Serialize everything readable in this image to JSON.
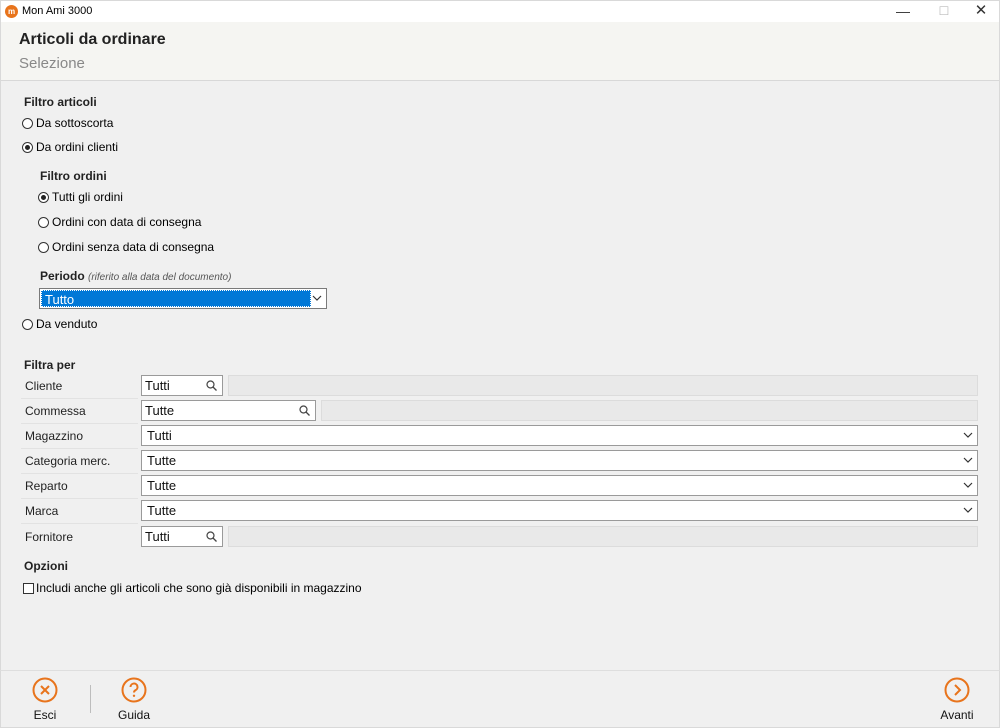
{
  "window": {
    "title": "Mon Ami 3000",
    "app_icon_text": "m"
  },
  "header": {
    "title": "Articoli da ordinare",
    "subtitle": "Selezione"
  },
  "filtro_articoli": {
    "label": "Filtro articoli",
    "options": [
      {
        "label": "Da sottoscorta",
        "selected": false
      },
      {
        "label": "Da ordini clienti",
        "selected": true
      },
      {
        "label": "Da venduto",
        "selected": false
      }
    ]
  },
  "filtro_ordini": {
    "label": "Filtro ordini",
    "options": [
      {
        "label": "Tutti gli ordini",
        "selected": true
      },
      {
        "label": "Ordini con data di consegna",
        "selected": false
      },
      {
        "label": "Ordini senza data di consegna",
        "selected": false
      }
    ]
  },
  "periodo": {
    "label": "Periodo",
    "note": "(riferito alla data del documento)",
    "value": "Tutto"
  },
  "filtra_per": {
    "label": "Filtra per",
    "rows": [
      {
        "label": "Cliente",
        "value": "Tutti"
      },
      {
        "label": "Commessa",
        "value": "Tutte"
      },
      {
        "label": "Magazzino",
        "value": "Tutti"
      },
      {
        "label": "Categoria merc.",
        "value": "Tutte"
      },
      {
        "label": "Reparto",
        "value": "Tutte"
      },
      {
        "label": "Marca",
        "value": "Tutte"
      },
      {
        "label": "Fornitore",
        "value": "Tutti"
      }
    ]
  },
  "opzioni": {
    "label": "Opzioni",
    "checkbox_label": "Includi anche gli articoli che sono già disponibili in magazzino",
    "checked": false
  },
  "footer": {
    "esci_label": "Esci",
    "guida_label": "Guida",
    "avanti_label": "Avanti"
  },
  "colors": {
    "accent_orange": "#e8741c",
    "selection_blue": "#0078d7"
  },
  "icons": {
    "esci": "close-circle-icon",
    "guida": "help-circle-icon",
    "avanti": "arrow-right-circle-icon",
    "search": "search-icon",
    "dropdown": "chevron-down-icon"
  }
}
